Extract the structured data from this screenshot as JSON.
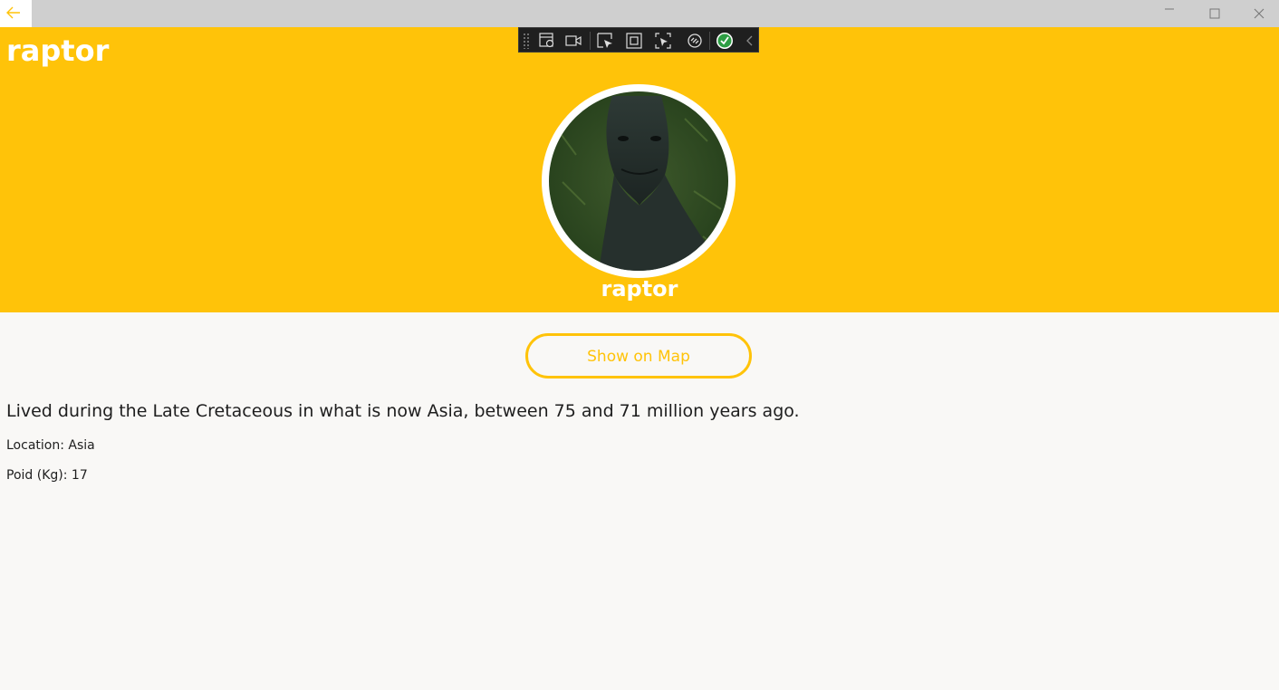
{
  "app": {
    "accent_color": "#ffc309",
    "back_icon": "back-arrow-icon",
    "window_controls": [
      "minimize-icon",
      "maximize-icon",
      "close-icon"
    ]
  },
  "header": {
    "title": "raptor",
    "avatar_name": "raptor",
    "avatar_image": "raptor-photo"
  },
  "debug_toolbar": {
    "icons": [
      "live-visual-tree-icon",
      "record-icon",
      "select-element-icon",
      "display-layout-adorners-icon",
      "track-focused-element-icon",
      "hot-reload-icon",
      "binding-failures-ok-icon",
      "collapse-chevron-icon"
    ]
  },
  "content": {
    "map_button_label": "Show on Map",
    "description": "Lived during the Late Cretaceous in what is now Asia, between 75 and 71 million years ago.",
    "location_label": "Location:",
    "location_value": "Asia",
    "poid_label": "Poid (Kg):",
    "poid_value": "17"
  }
}
